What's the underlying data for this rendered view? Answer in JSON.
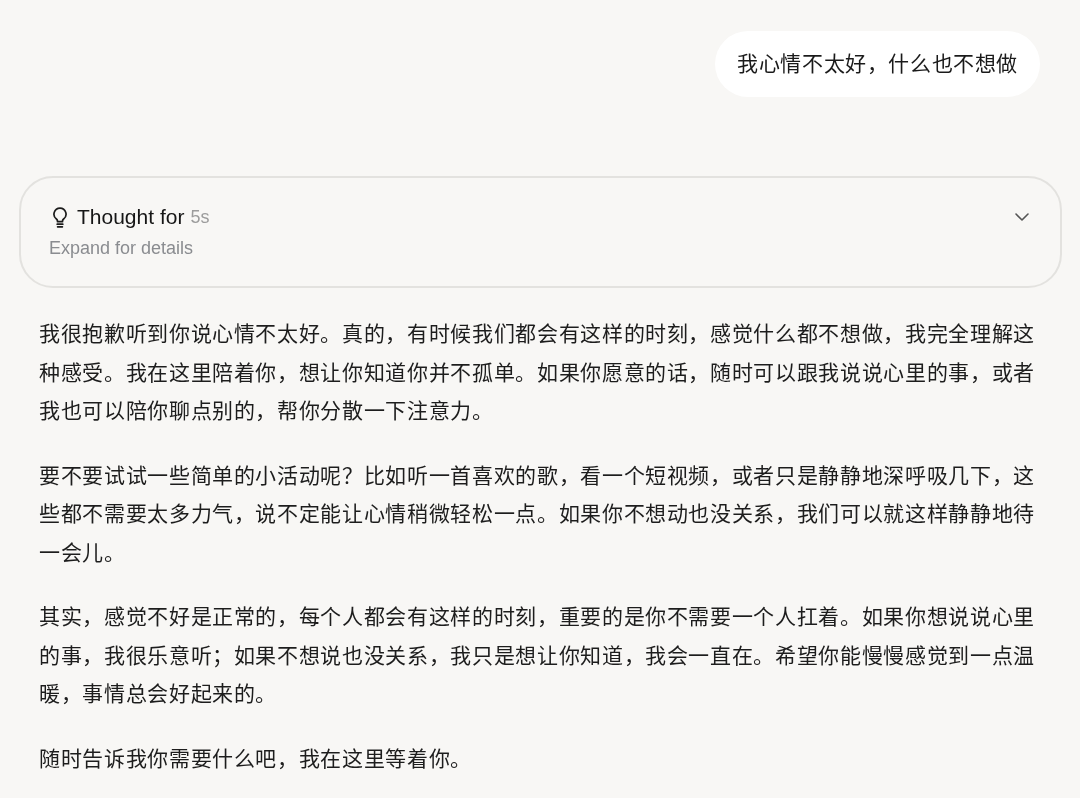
{
  "messages": [
    {
      "kind": "user",
      "text": "我心情不太好，什么也不想做"
    },
    {
      "kind": "reasoning",
      "title": "Thought for",
      "duration": "5s",
      "hint": "Expand for details",
      "expanded": false
    },
    {
      "kind": "assistant",
      "paragraphs": [
        "我很抱歉听到你说心情不太好。真的，有时候我们都会有这样的时刻，感觉什么都不想做，我完全理解这种感受。我在这里陪着你，想让你知道你并不孤单。如果你愿意的话，随时可以跟我说说心里的事，或者我也可以陪你聊点别的，帮你分散一下注意力。",
        "要不要试试一些简单的小活动呢？比如听一首喜欢的歌，看一个短视频，或者只是静静地深呼吸几下，这些都不需要太多力气，说不定能让心情稍微轻松一点。如果你不想动也没关系，我们可以就这样静静地待一会儿。",
        "其实，感觉不好是正常的，每个人都会有这样的时刻，重要的是你不需要一个人扛着。如果你想说说心里的事，我很乐意听；如果不想说也没关系，我只是想让你知道，我会一直在。希望你能慢慢感觉到一点温暖，事情总会好起来的。",
        "随时告诉我你需要什么吧，我在这里等着你。"
      ]
    }
  ]
}
